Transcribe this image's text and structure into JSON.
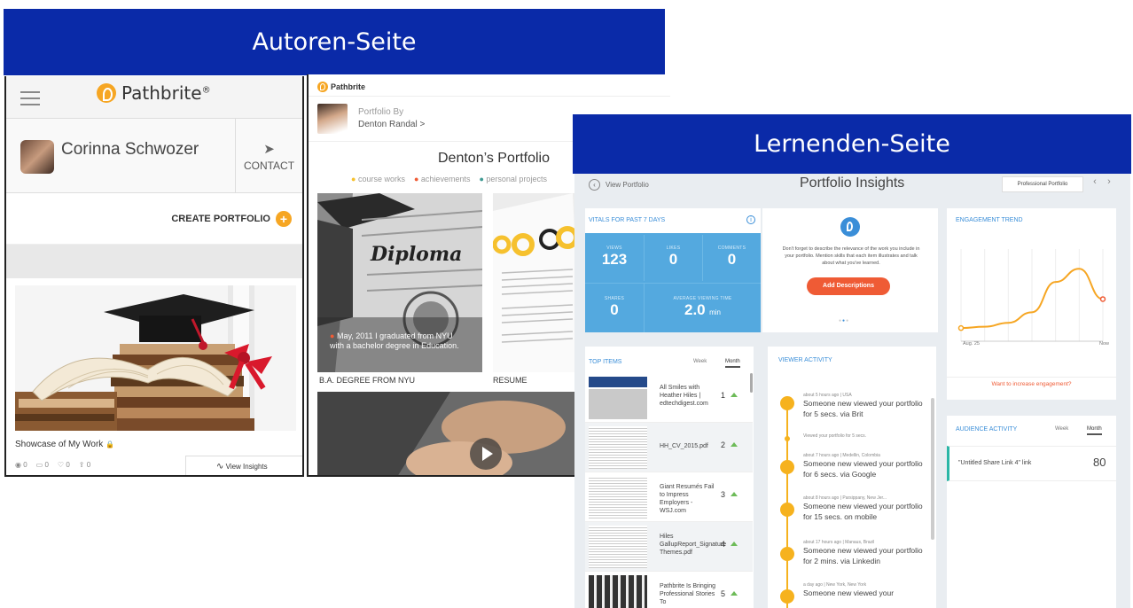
{
  "banners": {
    "author": "Autoren-Seite",
    "learner": "Lernenden-Seite"
  },
  "colors": {
    "banner": "#0a2aa8",
    "brand": "#f6a623",
    "accent": "#3a8ed8",
    "cta": "#ef5b35",
    "vitals": "#54a9df"
  },
  "author_page": {
    "logo_text": "Pathbrite",
    "logo_mark": "®",
    "user_name": "Corinna Schwozer",
    "contact_label": "CONTACT",
    "create_portfolio_label": "CREATE PORTFOLIO",
    "plus_symbol": "+",
    "showcase_title": "Showcase of My Work",
    "stats": [
      "0",
      "0",
      "0",
      "0"
    ],
    "view_insights_label": "View Insights"
  },
  "portfolio_view": {
    "logo_text": "Pathbrite",
    "portfolio_by_label": "Portfolio By",
    "author_link": "Denton Randal >",
    "portfolio_title": "Denton’s Portfolio",
    "categories": [
      "course works",
      "achievements",
      "personal projects"
    ],
    "category_colors": [
      "#f6c12e",
      "#ef5b35",
      "#3f9a93"
    ],
    "diploma_word": "Diploma",
    "tile1_caption": "May, 2011 I graduated from NYU with a bachelor degree in Education.",
    "tile1_label": "B.A. DEGREE FROM NYU",
    "tile2_label": "RESUME"
  },
  "insights": {
    "back_label": "View Portfolio",
    "title": "Portfolio Insights",
    "selector_label": "Professional Portfolio",
    "vitals_title": "VITALS FOR PAST 7 DAYS",
    "vitals": [
      {
        "label": "VIEWS",
        "value": "123"
      },
      {
        "label": "LIKES",
        "value": "0"
      },
      {
        "label": "COMMENTS",
        "value": "0"
      },
      {
        "label": "SHARES",
        "value": "0"
      },
      {
        "label": "AVERAGE VIEWING TIME",
        "value": "2.0",
        "unit": "min"
      }
    ],
    "tip_text": "Don't forget to describe the relevance of the work you include in your portfolio. Mention skills that each item illustrates and talk about what you've learned.",
    "tip_button": "Add Descriptions",
    "trend_title": "ENGAGEMENT TREND",
    "trend_start": "Aug. 25",
    "trend_end": "Now",
    "engagement_link": "Want to increase engagement?",
    "top_items_title": "TOP ITEMS",
    "week_label": "Week",
    "month_label": "Month",
    "top_items": [
      {
        "name": "All Smiles with Heather Hiles | edtechdigest.com",
        "rank": "1"
      },
      {
        "name": "HH_CV_2015.pdf",
        "rank": "2"
      },
      {
        "name": "Giant Resumés Fail to Impress Employers - WSJ.com",
        "rank": "3"
      },
      {
        "name": "Hiles GallupReport_Signature Themes.pdf",
        "rank": "4"
      },
      {
        "name": "Pathbrite Is Bringing Professional Stories To",
        "rank": "5"
      }
    ],
    "viewer_title": "VIEWER ACTIVITY",
    "viewer_items": [
      {
        "meta": "about 5 hours ago | USA",
        "text": "Someone new viewed your portfolio for 5 secs. via Brit"
      },
      {
        "meta": "Viewed your portfolio for 5 secs.",
        "text": ""
      },
      {
        "meta": "about 7 hours ago | Medellin, Colombia",
        "text": "Someone new viewed your portfolio for 6 secs. via Google"
      },
      {
        "meta": "about 8 hours ago | Parsippany, New Jer...",
        "text": "Someone new viewed your portfolio for 15 secs. on mobile"
      },
      {
        "meta": "about 17 hours ago | Manaus, Brazil",
        "text": "Someone new viewed your portfolio for 2 mins. via Linkedin"
      },
      {
        "meta": "a day ago | New York, New York",
        "text": "Someone new viewed your"
      }
    ],
    "audience_title": "AUDIENCE ACTIVITY",
    "audience_row": {
      "label": "\"Untitled Share Link 4\" link",
      "value": "80"
    }
  },
  "chart_data": {
    "type": "line",
    "title": "ENGAGEMENT TREND",
    "x": [
      "Aug. 25",
      "",
      "",
      "",
      "",
      "",
      "Now"
    ],
    "series": [
      {
        "values": [
          10,
          11,
          14,
          22,
          45,
          55,
          32
        ]
      }
    ],
    "ylim": [
      0,
      70
    ],
    "grid": true
  }
}
